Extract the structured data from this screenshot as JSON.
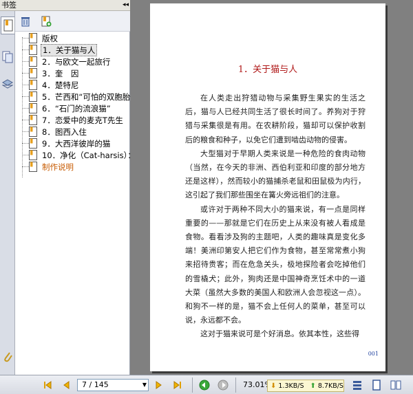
{
  "panel": {
    "title": "书签",
    "collapse_glyph": "◂◂"
  },
  "tabs": [
    {
      "name": "bookmarks",
      "icon": "bookmark-icon"
    },
    {
      "name": "pages",
      "icon": "pages-icon"
    },
    {
      "name": "layers",
      "icon": "layers-icon"
    },
    {
      "name": "attachments",
      "icon": "paperclip-icon"
    }
  ],
  "toolbar": {
    "delete_icon": "trash-icon",
    "new_icon": "new-bookmark-icon"
  },
  "bookmarks": [
    {
      "label": "版权",
      "selected": false,
      "link": false
    },
    {
      "label": "1．关于猫与人",
      "selected": true,
      "link": false
    },
    {
      "label": "2．与欧文一起旅行",
      "selected": false,
      "link": false
    },
    {
      "label": "3．奎　因",
      "selected": false,
      "link": false
    },
    {
      "label": "4．楚特尼",
      "selected": false,
      "link": false
    },
    {
      "label": "5．芒西和“可怕的双胞胎”",
      "selected": false,
      "link": false
    },
    {
      "label": "6．“石门的流浪猫”",
      "selected": false,
      "link": false
    },
    {
      "label": "7．恋爱中的麦克T先生",
      "selected": false,
      "link": false
    },
    {
      "label": "8．图西入住",
      "selected": false,
      "link": false
    },
    {
      "label": "9．大西洋彼岸的猫",
      "selected": false,
      "link": false
    },
    {
      "label": "10．净化（Cat-harsis）：",
      "selected": false,
      "link": false
    },
    {
      "label": "制作说明",
      "selected": false,
      "link": true
    }
  ],
  "document": {
    "chapter_title": "1．关于猫与人",
    "paragraphs": [
      "在人类走出狩猎动物与采集野生果实的生活之后，猫与人已经共同生活了很长时间了。养狗对于狩猎与采集很是有用。在农耕阶段，猫却可以保护收割后的粮食和种子，以免它们遭到啮齿动物的侵害。",
      "大型猫对于早期人类来说是一种危险的食肉动物（当然，在今天的非洲、西伯利亚和印度的部分地方还是这样），然而较小的猫捕杀老鼠和田鼠极为内行，这引起了我们那些围坐在篝火旁远祖们的注意。",
      "或许对于两种不同大小的猫来说，有一点是同样重要的——那就是它们在历史上从来没有被人看成是食物。看看涉及狗的主题吧，人类的趣味真是变化多端！美洲印第安人把它们作为食物，甚至常常煮小狗来招待贵客；而在危急关头，极地探险者会吃掉他们的雪橇犬；此外，狗肉还是中国神奇烹饪术中的一道大菜（虽然大多数的美国人和欧洲人会忽视这一点）。和狗不一样的是，猫不会上任何人的菜单，甚至可以说，永远都不会。",
      "这对于猫来说可是个好消息。依其本性，这些得"
    ],
    "page_number": "001"
  },
  "status": {
    "page_display": "7 / 145",
    "zoom": "73.01%",
    "download_speed": "1.3KB/S",
    "upload_speed": "8.7KB/S"
  },
  "colors": {
    "chapter_title": "#b01818",
    "link": "#c75a00",
    "page_number": "#1d3f9e"
  }
}
